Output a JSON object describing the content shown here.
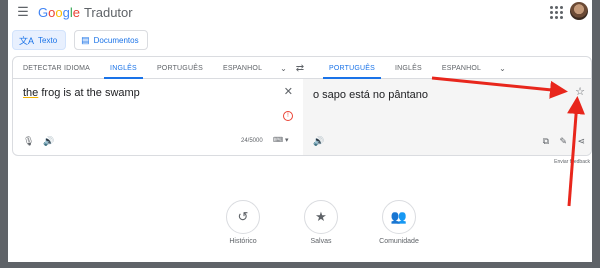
{
  "app": {
    "logo": [
      "G",
      "o",
      "o",
      "g",
      "l",
      "e"
    ],
    "product": "Tradutor"
  },
  "modes": [
    {
      "label": "Texto",
      "icon": "translate-icon"
    },
    {
      "label": "Documentos",
      "icon": "document-icon"
    }
  ],
  "source_langs": [
    "DETECTAR IDIOMA",
    "INGLÊS",
    "PORTUGUÊS",
    "ESPANHOL"
  ],
  "target_langs": [
    "PORTUGUÊS",
    "INGLÊS",
    "ESPANHOL"
  ],
  "source": {
    "text_underlined": "the",
    "text_rest": " frog is at the swamp",
    "char_count": "24/5000"
  },
  "target": {
    "text": "o sapo está no pântano"
  },
  "feedback": "Enviar feedback",
  "quick": [
    {
      "label": "Histórico",
      "icon": "history-icon"
    },
    {
      "label": "Salvas",
      "icon": "star-icon"
    },
    {
      "label": "Comunidade",
      "icon": "community-icon"
    }
  ],
  "annotation": {
    "arrow_color": "#e8261c"
  }
}
